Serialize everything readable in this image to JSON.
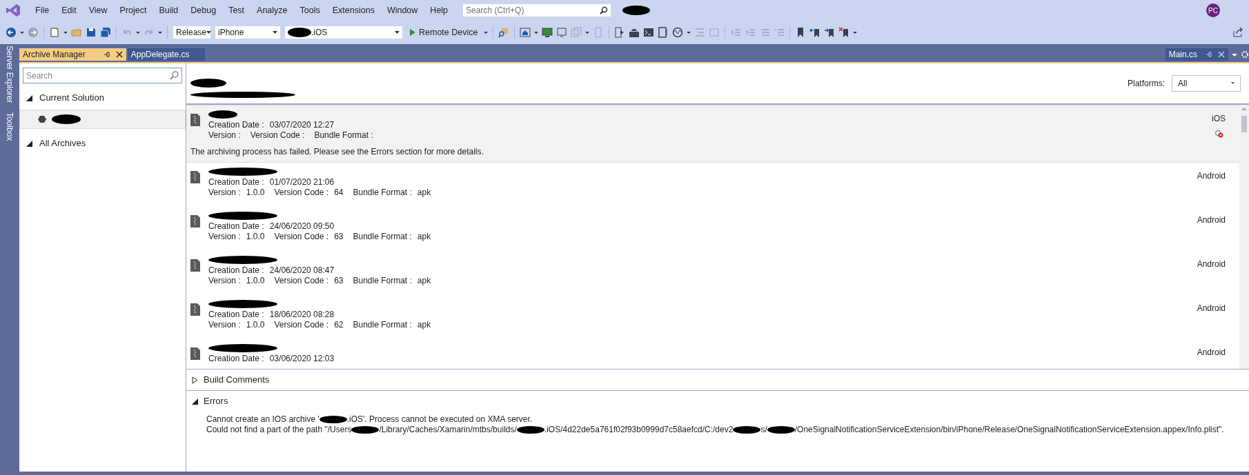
{
  "menu": [
    "File",
    "Edit",
    "View",
    "Project",
    "Build",
    "Debug",
    "Test",
    "Analyze",
    "Tools",
    "Extensions",
    "Window",
    "Help"
  ],
  "search": {
    "placeholder": "Search (Ctrl+Q)"
  },
  "account": {
    "initials": "PC"
  },
  "toolbar": {
    "configuration": "Release",
    "device": "iPhone",
    "project_suffix": ".iOS",
    "run_button": "Remote Device"
  },
  "side_tabs": [
    "Server Explorer",
    "Toolbox"
  ],
  "doc_tabs": [
    {
      "label": "Archive Manager",
      "selected": true
    },
    {
      "label": "AppDelegate.cs",
      "selected": false
    }
  ],
  "right_tab": {
    "label": "Main.cs"
  },
  "left_pane": {
    "search": {
      "placeholder": "Search"
    },
    "tree": [
      {
        "label": "Current Solution",
        "expanded": true,
        "children": [
          {
            "selected": true
          }
        ]
      },
      {
        "label": "All Archives",
        "expanded": true
      }
    ]
  },
  "header": {
    "platforms_label": "Platforms:",
    "platforms_value": "All"
  },
  "archives": [
    {
      "selected": true,
      "failed": true,
      "platform": "iOS",
      "lines": [
        [
          {
            "label": "Creation Date :",
            "value": "03/07/2020 12:27"
          }
        ],
        [
          {
            "label": "Version :"
          },
          {
            "label": "Version Code :"
          },
          {
            "label": "Bundle Format :"
          }
        ]
      ],
      "message": "The archiving process has failed. Please see the Errors section for more details."
    },
    {
      "selected": false,
      "failed": false,
      "platform": "Android",
      "lines": [
        [
          {
            "label": "Creation Date :",
            "value": "01/07/2020 21:06"
          }
        ],
        [
          {
            "label": "Version :",
            "value": "1.0.0"
          },
          {
            "label": "Version Code :",
            "value": "64"
          },
          {
            "label": "Bundle Format :",
            "value": "apk"
          }
        ]
      ]
    },
    {
      "selected": false,
      "failed": false,
      "platform": "Android",
      "lines": [
        [
          {
            "label": "Creation Date :",
            "value": "24/06/2020 09:50"
          }
        ],
        [
          {
            "label": "Version :",
            "value": "1.0.0"
          },
          {
            "label": "Version Code :",
            "value": "63"
          },
          {
            "label": "Bundle Format :",
            "value": "apk"
          }
        ]
      ]
    },
    {
      "selected": false,
      "failed": false,
      "platform": "Android",
      "lines": [
        [
          {
            "label": "Creation Date :",
            "value": "24/06/2020 08:47"
          }
        ],
        [
          {
            "label": "Version :",
            "value": "1.0.0"
          },
          {
            "label": "Version Code :",
            "value": "63"
          },
          {
            "label": "Bundle Format :",
            "value": "apk"
          }
        ]
      ]
    },
    {
      "selected": false,
      "failed": false,
      "platform": "Android",
      "lines": [
        [
          {
            "label": "Creation Date :",
            "value": "18/06/2020 08:28"
          }
        ],
        [
          {
            "label": "Version :",
            "value": "1.0.0"
          },
          {
            "label": "Version Code :",
            "value": "62"
          },
          {
            "label": "Bundle Format :",
            "value": "apk"
          }
        ]
      ]
    },
    {
      "selected": false,
      "failed": false,
      "platform": "Android",
      "lines": [
        [
          {
            "label": "Creation Date :",
            "value": "03/06/2020 12:03"
          }
        ]
      ]
    }
  ],
  "sections": [
    {
      "title": "Build Comments",
      "expanded": false
    },
    {
      "title": "Errors",
      "expanded": true,
      "lines": [
        [
          {
            "kind": "text",
            "text": "Cannot create an IOS archive '"
          },
          {
            "kind": "redacted"
          },
          {
            "kind": "text",
            "text": ".iOS'. Process cannot be executed on XMA server."
          }
        ],
        [
          {
            "kind": "text",
            "text": "Could not find a part of the path \"/Users"
          },
          {
            "kind": "redacted"
          },
          {
            "kind": "text",
            "text": "/Library/Caches/Xamarin/mtbs/builds/"
          },
          {
            "kind": "redacted"
          },
          {
            "kind": "text",
            "text": ".iOS/4d22de5a761f02f93b0999d7c58aefcd/C:/dev2"
          },
          {
            "kind": "redacted"
          },
          {
            "kind": "text",
            "text": "s/"
          },
          {
            "kind": "redacted"
          },
          {
            "kind": "text",
            "text": "/OneSignalNotificationServiceExtension/bin/iPhone/Release/OneSignalNotificationServiceExtension.appex/Info.plist\"."
          }
        ]
      ]
    }
  ]
}
